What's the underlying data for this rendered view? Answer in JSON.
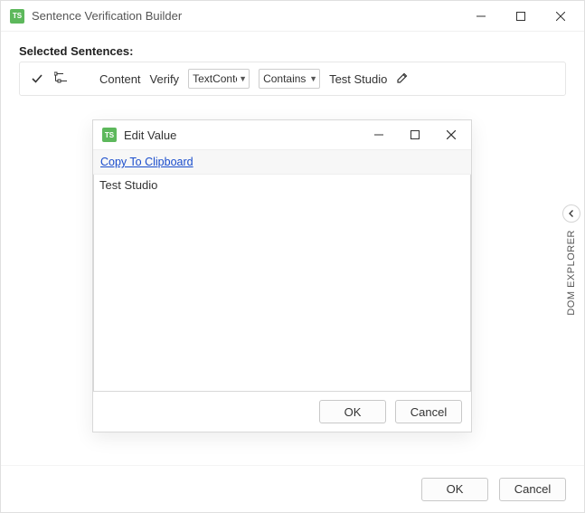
{
  "window": {
    "title": "Sentence Verification Builder"
  },
  "main": {
    "section_label": "Selected Sentences:",
    "content_label": "Content",
    "verify_label": "Verify",
    "select1": "TextContent",
    "select2": "Contains",
    "value_text": "Test Studio"
  },
  "dialog": {
    "title": "Edit Value",
    "copy_link": "Copy To Clipboard",
    "body": "Test Studio",
    "ok": "OK",
    "cancel": "Cancel"
  },
  "footer": {
    "ok": "OK",
    "cancel": "Cancel"
  },
  "dom_explorer_label": "DOM EXPLORER"
}
